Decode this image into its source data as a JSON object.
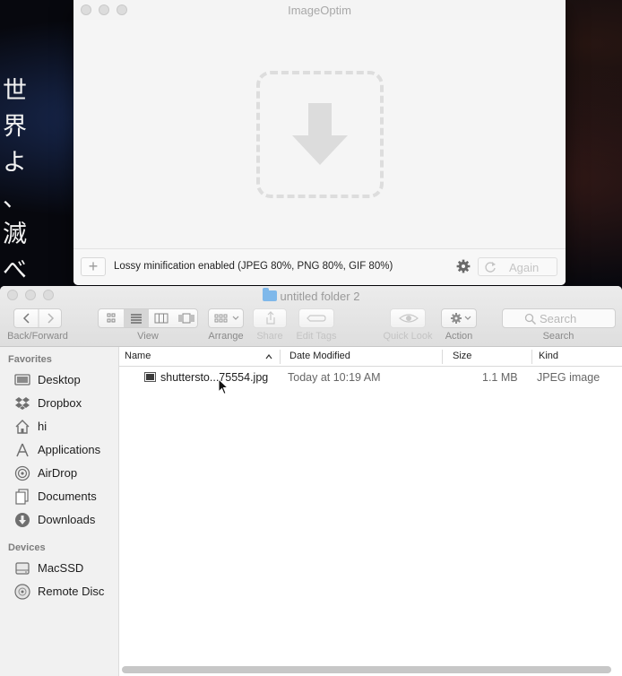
{
  "wallpaper": {
    "lines": [
      "世",
      "界",
      "よ",
      "、",
      "滅",
      "べ",
      "。"
    ]
  },
  "imageoptim": {
    "title": "ImageOptim",
    "add_label": "+",
    "status": "Lossy minification enabled (JPEG 80%, PNG 80%, GIF 80%)",
    "again_label": "Again",
    "icons": [
      "download-arrow-icon",
      "gear-icon",
      "reload-icon"
    ]
  },
  "finder": {
    "title": "untitled folder 2",
    "toolbar": {
      "back_forward": "Back/Forward",
      "view": "View",
      "arrange": "Arrange",
      "share": "Share",
      "edit_tags": "Edit Tags",
      "quick_look": "Quick Look",
      "action": "Action",
      "search_placeholder": "Search",
      "search_label": "Search"
    },
    "sidebar": {
      "favorites_header": "Favorites",
      "favorites": [
        {
          "label": "Desktop",
          "icon": "desktop-icon"
        },
        {
          "label": "Dropbox",
          "icon": "dropbox-icon"
        },
        {
          "label": "hi",
          "icon": "home-icon"
        },
        {
          "label": "Applications",
          "icon": "applications-icon"
        },
        {
          "label": "AirDrop",
          "icon": "airdrop-icon"
        },
        {
          "label": "Documents",
          "icon": "documents-icon"
        },
        {
          "label": "Downloads",
          "icon": "downloads-icon"
        }
      ],
      "devices_header": "Devices",
      "devices": [
        {
          "label": "MacSSD",
          "icon": "drive-icon"
        },
        {
          "label": "Remote Disc",
          "icon": "disc-icon"
        }
      ]
    },
    "columns": [
      "Name",
      "Date Modified",
      "Size",
      "Kind"
    ],
    "files": [
      {
        "name": "shuttersto...75554.jpg",
        "date": "Today at 10:19 AM",
        "size": "1.1 MB",
        "kind": "JPEG image"
      }
    ],
    "colors": {
      "folder": "#7fb8ea",
      "toolbar": "#e6e6e6"
    }
  }
}
